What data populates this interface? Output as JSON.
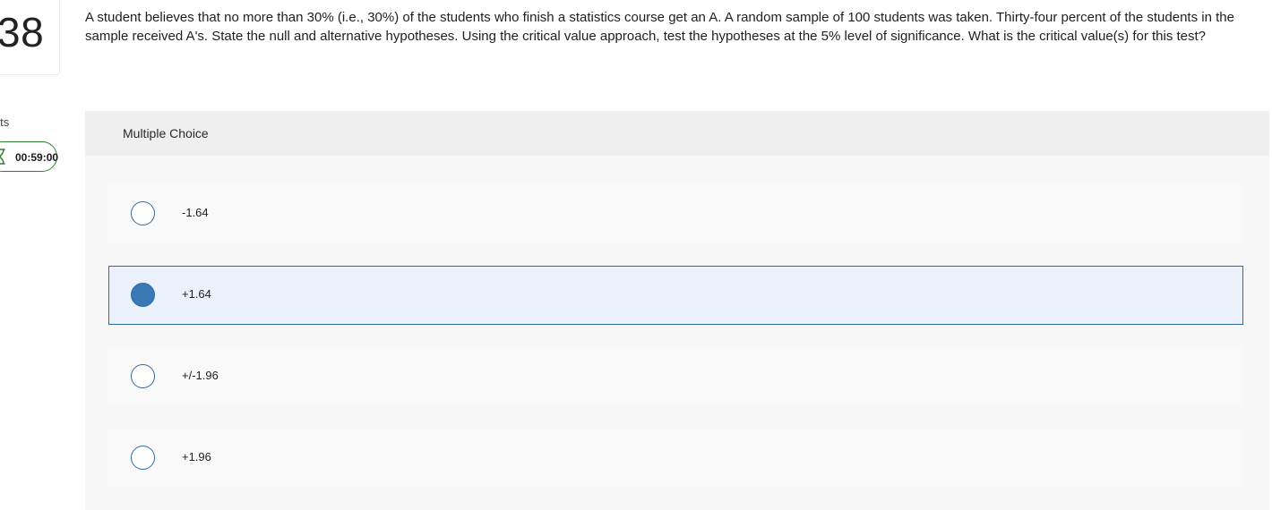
{
  "question_number": "38",
  "points_label": "ints",
  "timer": {
    "icon": "hourglass-icon",
    "value": "00:59:00",
    "color": "#2f7d32"
  },
  "question_text": "A student believes that no more than 30% (i.e.,  30%) of the students who finish a statistics course get an A. A random sample of 100 students was taken. Thirty-four percent of the students in the sample received A's.  State the null and alternative hypotheses.  Using the critical value approach, test the hypotheses at the 5% level of significance.  What is the critical value(s) for this test?",
  "answer_panel": {
    "header": "Multiple Choice",
    "options": [
      {
        "label": "-1.64",
        "selected": false
      },
      {
        "label": "+1.64",
        "selected": true
      },
      {
        "label": "+/-1.96",
        "selected": false
      },
      {
        "label": "+1.96",
        "selected": false
      }
    ]
  },
  "colors": {
    "accent": "#2e6aa8",
    "selected_fill": "#3c78b4",
    "selected_bg": "#eaf1fa"
  }
}
